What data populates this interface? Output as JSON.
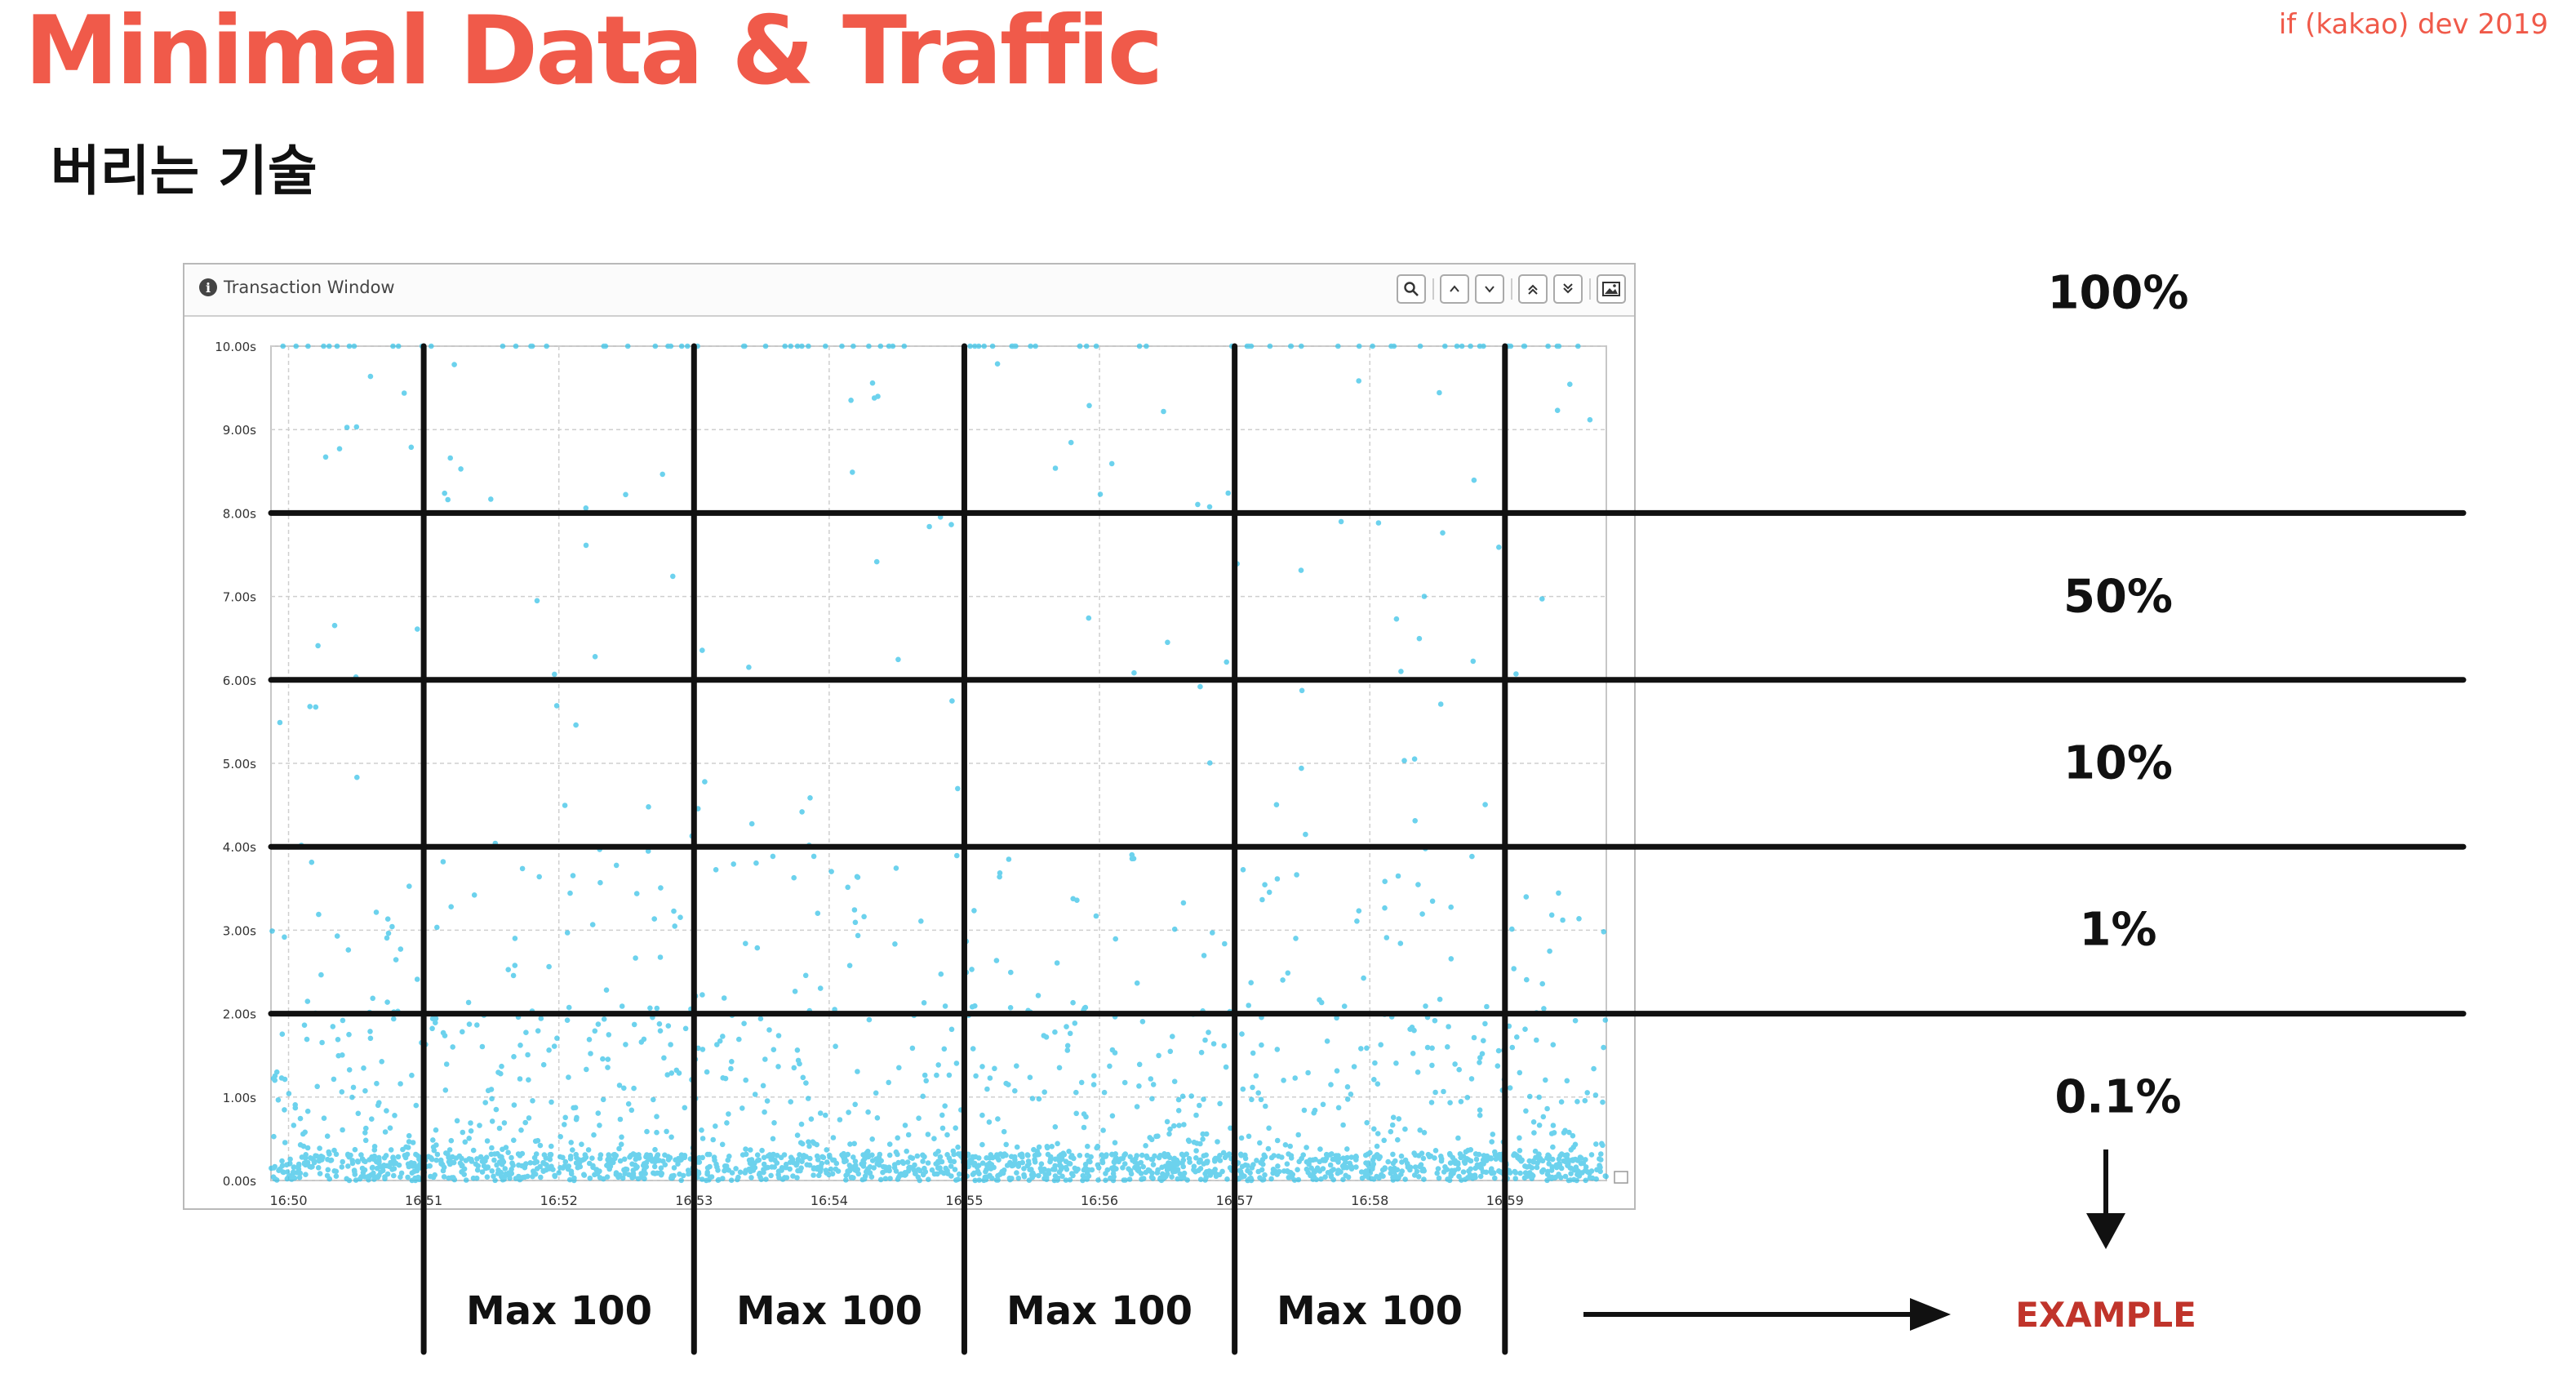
{
  "slide": {
    "title": "Minimal Data & Traffic",
    "brand": "if (kakao) dev 2019",
    "subtitle": "버리는 기술"
  },
  "window": {
    "title": "Transaction Window",
    "toolbar_icons": [
      "search-icon",
      "chevron-up-icon",
      "chevron-down-icon",
      "double-chevron-up-icon",
      "double-chevron-down-icon",
      "image-icon"
    ]
  },
  "chart_data": {
    "type": "scatter",
    "x_tick_labels": [
      "16:50",
      "16:51",
      "16:52",
      "16:53",
      "16:54",
      "16:55",
      "16:56",
      "16:57",
      "16:58",
      "16:59"
    ],
    "x_ticks_min": [
      0,
      1,
      2,
      3,
      4,
      5,
      6,
      7,
      8,
      9
    ],
    "xlim_min": [
      -0.13,
      9.75
    ],
    "y_tick_labels": [
      "0.00s",
      "1.00s",
      "2.00s",
      "3.00s",
      "4.00s",
      "5.00s",
      "6.00s",
      "7.00s",
      "8.00s",
      "9.00s",
      "10.00s"
    ],
    "ylim": [
      0,
      10
    ],
    "grid": true,
    "point_color": "#3cc3e8",
    "distribution_note": "dense band at 0.0–0.3s; many points up to 2s; sparse between 2s and 10s; cluster at the 10.00s cap",
    "overlay": {
      "horizontal_thresholds_s": [
        8,
        6,
        4,
        2
      ],
      "bucket_boundaries_min": [
        1,
        3,
        5,
        7,
        9
      ],
      "band_labels": [
        "100%",
        "50%",
        "10%",
        "1%",
        "0.1%"
      ],
      "bucket_labels": [
        "Max 100",
        "Max 100",
        "Max 100",
        "Max 100"
      ],
      "example_label": "EXAMPLE"
    }
  }
}
